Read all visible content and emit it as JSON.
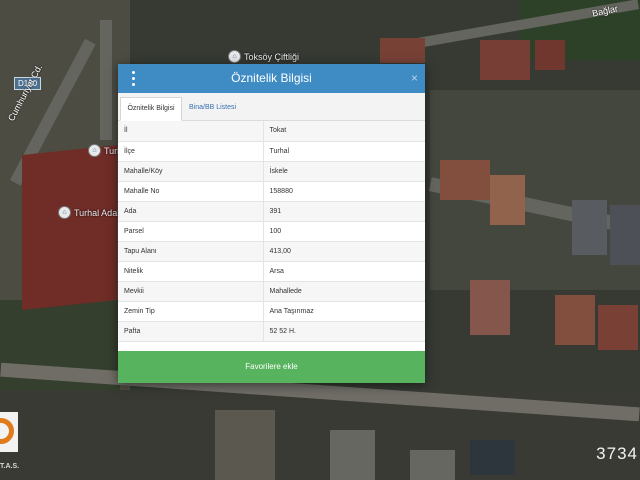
{
  "map": {
    "road_shield": "D190",
    "road_labels": [
      "Cumhuriyet Cd.",
      "Bağlar"
    ],
    "pois": [
      "Toksöy Çiftliği",
      "Turhal",
      "Turhal Adal"
    ],
    "watermark": "3734",
    "logo_text": "T.A.S."
  },
  "dialog": {
    "title": "Öznitelik Bilgisi",
    "close_symbol": "×",
    "tabs": [
      {
        "label": "Öznitelik Bilgisi",
        "active": true
      },
      {
        "label": "Bina/BB Listesi",
        "active": false
      }
    ],
    "rows": [
      {
        "key": "İl",
        "value": "Tokat"
      },
      {
        "key": "İlçe",
        "value": "Turhal"
      },
      {
        "key": "Mahalle/Köy",
        "value": "İskele"
      },
      {
        "key": "Mahalle No",
        "value": "158880"
      },
      {
        "key": "Ada",
        "value": "391"
      },
      {
        "key": "Parsel",
        "value": "100"
      },
      {
        "key": "Tapu Alanı",
        "value": "413,00"
      },
      {
        "key": "Nitelik",
        "value": "Arsa"
      },
      {
        "key": "Mevkii",
        "value": "Mahallede"
      },
      {
        "key": "Zemin Tip",
        "value": "Ana Taşınmaz"
      },
      {
        "key": "Pafta",
        "value": "52 52 H."
      }
    ],
    "favorite_button": "Favorilere ekle",
    "colors": {
      "header": "#3f8cc5",
      "button": "#57b35d",
      "link": "#3a6fb1"
    }
  }
}
